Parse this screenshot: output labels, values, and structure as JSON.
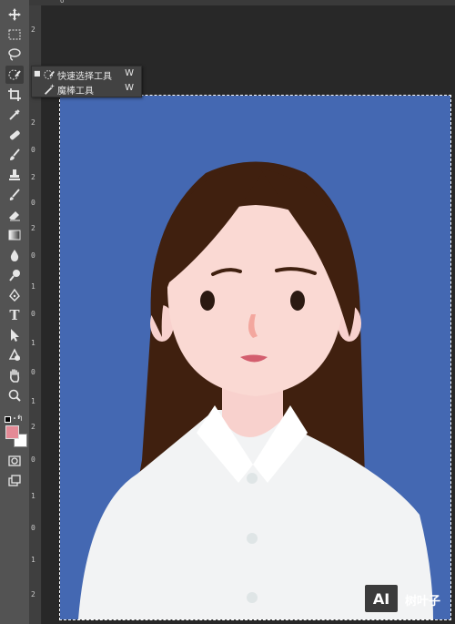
{
  "app": {
    "window": "Photoshop"
  },
  "tool_popup": {
    "items": [
      {
        "label": "快速选择工具",
        "shortcut": "W",
        "icon": "quick-selection-icon",
        "selected": true
      },
      {
        "label": "魔棒工具",
        "shortcut": "W",
        "icon": "magic-wand-icon",
        "selected": false
      }
    ]
  },
  "toolbar": {
    "tools": [
      "move-icon",
      "marquee-icon",
      "lasso-icon",
      "quick-selection-icon",
      "crop-icon",
      "eyedropper-icon",
      "healing-brush-icon",
      "brush-icon",
      "clone-stamp-icon",
      "history-brush-icon",
      "eraser-icon",
      "gradient-icon",
      "blur-icon",
      "dodge-icon",
      "pen-icon",
      "type-icon",
      "path-selection-icon",
      "shape-icon",
      "hand-icon",
      "zoom-icon",
      "more-icon"
    ],
    "type_glyph": "T",
    "more_glyph": "…",
    "foreground_color": "#e48a96",
    "background_color": "#ffffff"
  },
  "rulers": {
    "top_labels": [
      "0"
    ],
    "left_labels": [
      "2",
      "0",
      "2",
      "0",
      "2",
      "0",
      "2",
      "0",
      "1",
      "0",
      "1",
      "0",
      "1",
      "2",
      "0",
      "1",
      "0",
      "1",
      "2"
    ]
  },
  "canvas": {
    "background_color": "#4468b2"
  },
  "watermark": {
    "logo_text": "AI",
    "text": "树叶子"
  }
}
